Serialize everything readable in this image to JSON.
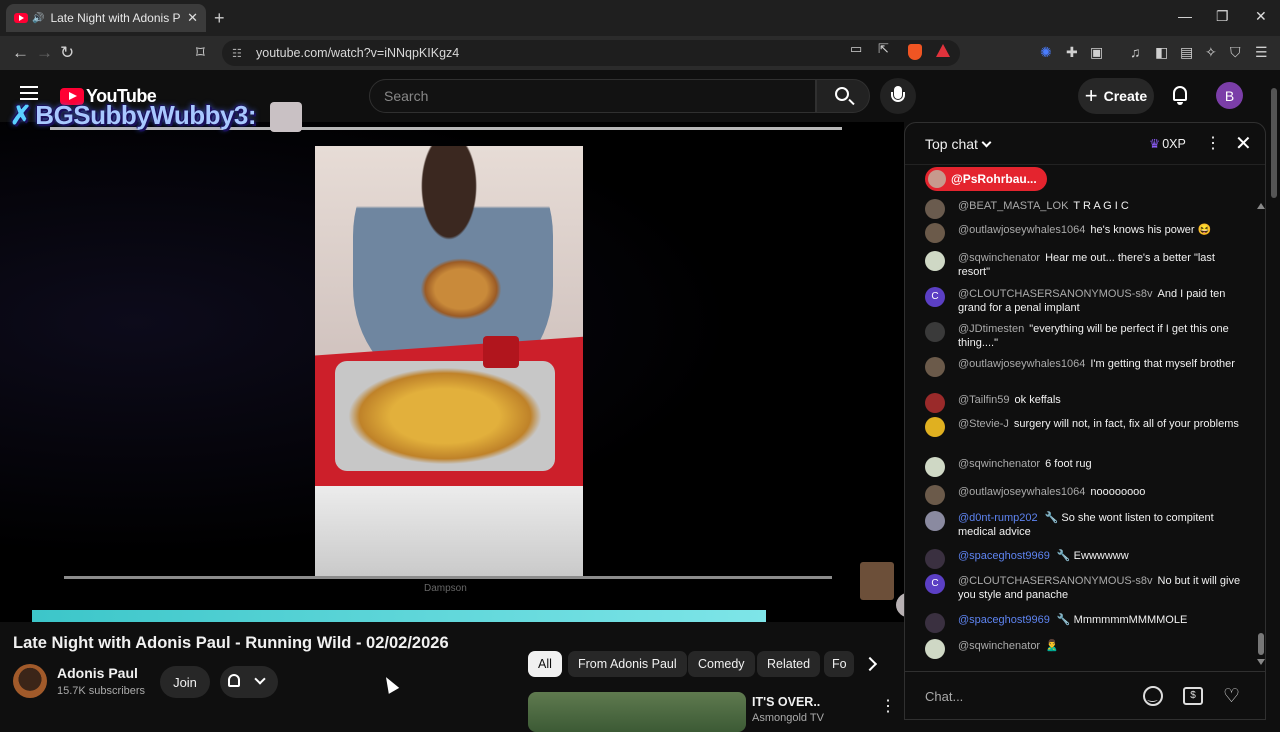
{
  "browser": {
    "tab_title": "Late Night with Adonis Paul -",
    "tab_close": "✕",
    "new_tab": "+",
    "url": "youtube.com/watch?v=iNNqpKIKgz4",
    "window_controls": {
      "minimize": "—",
      "restore": "❐",
      "close": "✕"
    },
    "icons": [
      "back-icon",
      "forward-icon",
      "reload-icon",
      "bookmark-icon",
      "site-info-icon",
      "cast-icon",
      "share-icon",
      "brave-shields-icon",
      "brave-rewards-icon",
      "vpn-icon",
      "extensions-icon",
      "reading-list-icon",
      "media-icon",
      "sidebar-icon",
      "wallet-icon",
      "leo-icon",
      "menu-icon"
    ]
  },
  "masthead": {
    "logo_text": "YouTube",
    "search_placeholder": "Search",
    "create_label": "Create",
    "avatar_letter": "B"
  },
  "player": {
    "overlay_name": "SubbyWubby3:",
    "overlay_badge": "BG",
    "clip_watermark": "Dampson",
    "progress": 0.0
  },
  "video": {
    "title": "Late Night with Adonis Paul - Running Wild - 02/02/2026",
    "channel_name": "Adonis Paul",
    "subscribers": "15.7K subscribers",
    "join_label": "Join"
  },
  "related": {
    "chips": [
      "All",
      "From Adonis Paul",
      "Comedy",
      "Related",
      "Fo"
    ],
    "active_chip": "All",
    "first_item": {
      "title": "IT'S OVER..",
      "channel": "Asmongold TV"
    }
  },
  "chat": {
    "mode_label": "Top chat",
    "xp_label": "0XP",
    "pinned_user": "@PsRohrbau...",
    "input_placeholder": "Chat...",
    "messages": [
      {
        "author": "@BEAT_MASTA_LOK",
        "text": "T R A G I C",
        "avatar_color": "#6a5b4e",
        "mod": false
      },
      {
        "author": "@outlawjoseywhales1064",
        "text": "he's knows his power 😆",
        "avatar_color": "#6b5a4a",
        "mod": false
      },
      {
        "author": "@sqwinchenator",
        "text": "Hear me out... there's a better \"last resort\"",
        "avatar_color": "#cfd8c5",
        "mod": false
      },
      {
        "author": "@CLOUTCHASERSANONYMOUS-s8v",
        "text": "And I paid ten grand for a penal implant",
        "avatar_color": "#5b3fc4",
        "mod": false,
        "avatar_letter": "C"
      },
      {
        "author": "@JDtimesten",
        "text": "\"everything will be perfect if I get this one thing....\"",
        "avatar_color": "#3a3a3a",
        "mod": false
      },
      {
        "author": "@outlawjoseywhales1064",
        "text": "I'm getting that myself brother",
        "avatar_color": "#6b5a4a",
        "mod": false
      },
      {
        "author": "@Tailfin59",
        "text": "ok keffals",
        "avatar_color": "#9a2a2a",
        "mod": false
      },
      {
        "author": "@Stevie-J",
        "text": "surgery will not, in fact, fix all of your problems",
        "avatar_color": "#e0b020",
        "mod": false
      },
      {
        "author": "@sqwinchenator",
        "text": "6 foot rug",
        "avatar_color": "#cfd8c5",
        "mod": false
      },
      {
        "author": "@outlawjoseywhales1064",
        "text": "noooooooo",
        "avatar_color": "#6b5a4a",
        "mod": false
      },
      {
        "author": "@d0nt-rump202",
        "text": "So she wont listen to compitent medical advice",
        "avatar_color": "#8a8aa0",
        "mod": true
      },
      {
        "author": "@spaceghost9969",
        "text": "Ewwwwww",
        "avatar_color": "#3a3040",
        "mod": true
      },
      {
        "author": "@CLOUTCHASERSANONYMOUS-s8v",
        "text": "No but it will give you style and panache",
        "avatar_color": "#5b3fc4",
        "mod": false,
        "avatar_letter": "C"
      },
      {
        "author": "@spaceghost9969",
        "text": "MmmmmmMMMMOLE",
        "avatar_color": "#3a3040",
        "mod": true
      },
      {
        "author": "@sqwinchenator",
        "text": "🙎‍♂️",
        "avatar_color": "#cfd8c5",
        "mod": false
      }
    ]
  },
  "colors": {
    "accent_red": "#ff0033",
    "pinned_red": "#e4242e",
    "mod_blue": "#5e84f1",
    "background": "#0f0f0f"
  }
}
